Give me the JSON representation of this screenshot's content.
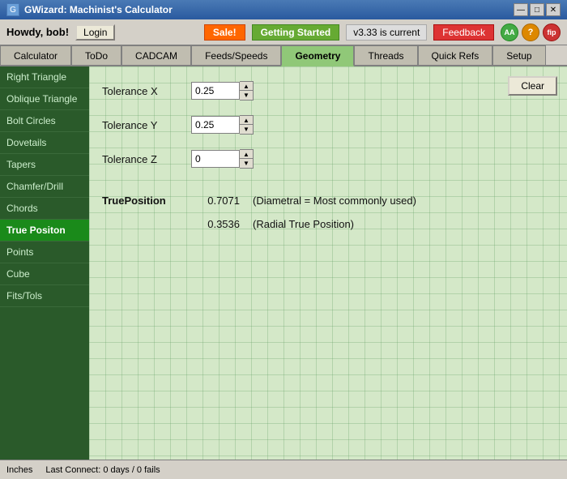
{
  "window": {
    "title": "GWizard: Machinist's Calculator",
    "icon": "G"
  },
  "title_buttons": {
    "minimize": "—",
    "maximize": "□",
    "close": "✕"
  },
  "header": {
    "howdy_label": "Howdy, bob!",
    "login_label": "Login",
    "sale_label": "Sale!",
    "getting_started_label": "Getting Started",
    "version_label": "v3.33 is current",
    "feedback_label": "Feedback",
    "icon1": "AA",
    "icon2": "?",
    "icon3": "fip"
  },
  "tabs": [
    {
      "id": "calculator",
      "label": "Calculator",
      "active": false
    },
    {
      "id": "todo",
      "label": "ToDo",
      "active": false
    },
    {
      "id": "cadcam",
      "label": "CADCAM",
      "active": false
    },
    {
      "id": "feeds_speeds",
      "label": "Feeds/Speeds",
      "active": false
    },
    {
      "id": "geometry",
      "label": "Geometry",
      "active": true
    },
    {
      "id": "threads",
      "label": "Threads",
      "active": false
    },
    {
      "id": "quick_refs",
      "label": "Quick Refs",
      "active": false
    },
    {
      "id": "setup",
      "label": "Setup",
      "active": false
    }
  ],
  "sidebar": {
    "items": [
      {
        "id": "right-triangle",
        "label": "Right Triangle",
        "active": false
      },
      {
        "id": "oblique-triangle",
        "label": "Oblique Triangle",
        "active": false
      },
      {
        "id": "bolt-circles",
        "label": "Bolt Circles",
        "active": false
      },
      {
        "id": "dovetails",
        "label": "Dovetails",
        "active": false
      },
      {
        "id": "tapers",
        "label": "Tapers",
        "active": false
      },
      {
        "id": "chamfer-drill",
        "label": "Chamfer/Drill",
        "active": false
      },
      {
        "id": "chords",
        "label": "Chords",
        "active": false
      },
      {
        "id": "true-position",
        "label": "True Positon",
        "active": true
      },
      {
        "id": "points",
        "label": "Points",
        "active": false
      },
      {
        "id": "cube",
        "label": "Cube",
        "active": false
      },
      {
        "id": "fits-tols",
        "label": "Fits/Tols",
        "active": false
      }
    ]
  },
  "content": {
    "clear_label": "Clear",
    "form": {
      "tolerance_x_label": "Tolerance X",
      "tolerance_x_value": "0.25",
      "tolerance_y_label": "Tolerance Y",
      "tolerance_y_value": "0.25",
      "tolerance_z_label": "Tolerance Z",
      "tolerance_z_value": "0"
    },
    "results": {
      "true_position_label": "TruePosition",
      "true_position_value": "0.7071",
      "true_position_desc": "(Diametral = Most commonly used)",
      "radial_value": "0.3536",
      "radial_desc": "(Radial True Position)"
    }
  },
  "status_bar": {
    "units": "Inches",
    "last_connect": "Last Connect: 0 days / 0 fails"
  }
}
